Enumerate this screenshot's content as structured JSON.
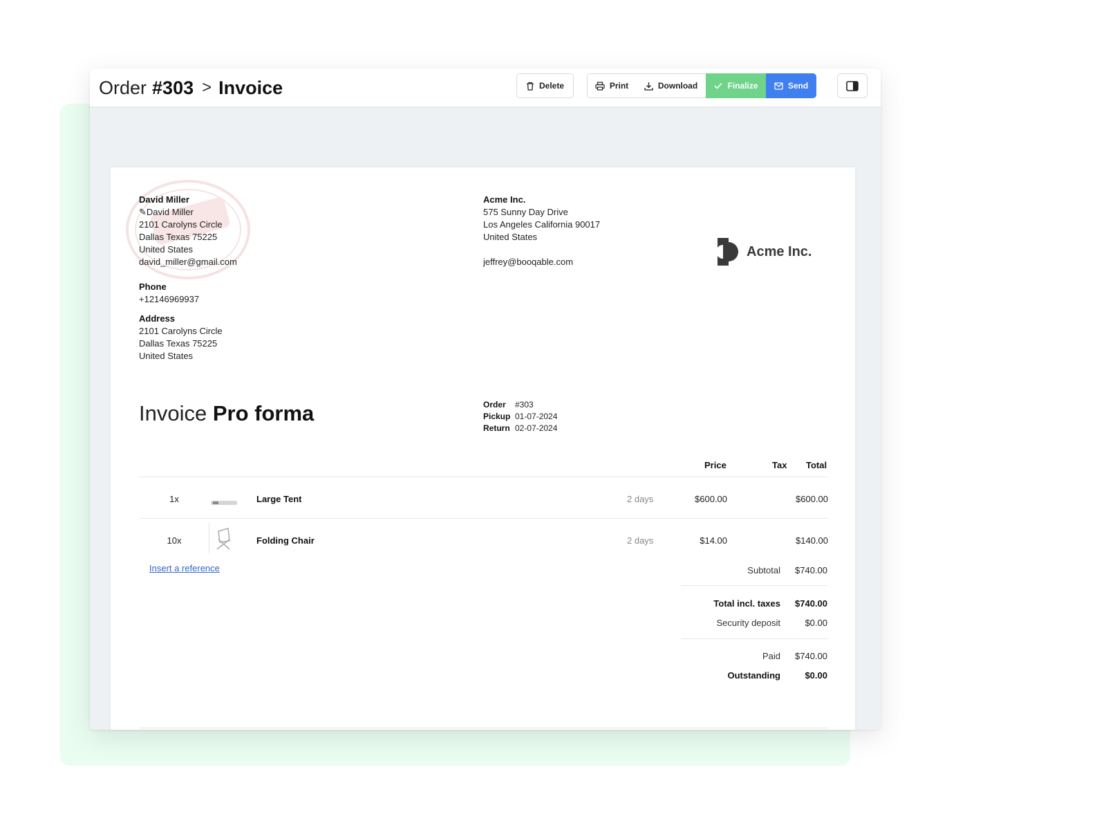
{
  "header": {
    "breadcrumb_prefix": "Order",
    "order_number": "#303",
    "separator": ">",
    "current_page": "Invoice"
  },
  "toolbar": {
    "delete_label": "Delete",
    "print_label": "Print",
    "download_label": "Download",
    "finalize_label": "Finalize",
    "send_label": "Send"
  },
  "colors": {
    "finalize": "#6fd48a",
    "send": "#3f7ff0",
    "accent_background": "#e9fdf0"
  },
  "customer": {
    "name": "David Miller",
    "contact": "David Miller",
    "street": "2101 Carolyns Circle",
    "city": "Dallas Texas 75225",
    "country": "United States",
    "email": "david_miller@gmail.com",
    "phone_label": "Phone",
    "phone": "+12146969937",
    "address_label": "Address",
    "address_street": "2101 Carolyns Circle",
    "address_city": "Dallas Texas 75225",
    "address_country": "United States"
  },
  "company": {
    "name": "Acme Inc.",
    "street": "575 Sunny Day Drive",
    "city": "Los Angeles California 90017",
    "country": "United States",
    "email": "jeffrey@booqable.com",
    "logo_text": "Acme Inc."
  },
  "invoice": {
    "title_light": "Invoice",
    "title_bold": "Pro forma",
    "meta": [
      {
        "key": "Order",
        "value": "#303"
      },
      {
        "key": "Pickup",
        "value": "01-07-2024"
      },
      {
        "key": "Return",
        "value": "02-07-2024"
      }
    ]
  },
  "table": {
    "headers": {
      "price": "Price",
      "tax": "Tax",
      "total": "Total"
    },
    "rows": [
      {
        "qty": "1x",
        "name": "Large Tent",
        "duration": "2 days",
        "price": "$600.00",
        "total": "$600.00",
        "thumb_icon": "tent-icon"
      },
      {
        "qty": "10x",
        "name": "Folding Chair",
        "duration": "2 days",
        "price": "$14.00",
        "total": "$140.00",
        "thumb_icon": "chair-icon"
      }
    ],
    "insert_reference": "Insert a reference"
  },
  "totals": {
    "subtotal_label": "Subtotal",
    "subtotal": "$740.00",
    "total_label": "Total incl. taxes",
    "total": "$740.00",
    "deposit_label": "Security deposit",
    "deposit": "$0.00",
    "paid_label": "Paid",
    "paid": "$740.00",
    "outstanding_label": "Outstanding",
    "outstanding": "$0.00"
  }
}
